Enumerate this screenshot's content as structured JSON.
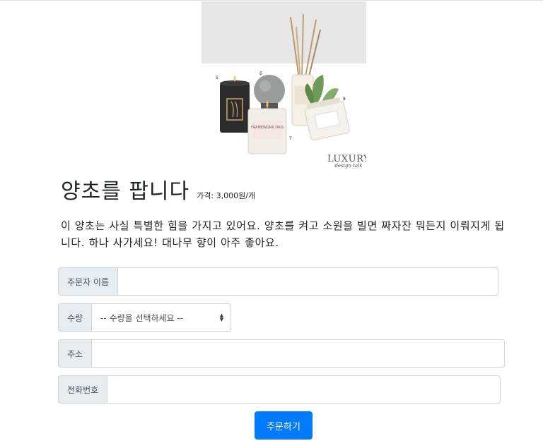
{
  "product": {
    "title": "양초를 팝니다",
    "price": "가격: 3,000원/개",
    "description": "이 양초는 사실 특별한 힘을 가지고 있어요. 양초를 켜고 소원을 빌면 짜자잔 뭐든지 이뤄지게 됩니다. 하나 사가세요! 대나무 향이 아주 좋아요.",
    "image": {
      "watermark_line1": "LUXURY",
      "watermark_line2": "design talk",
      "candle_labels": [
        "5",
        "6",
        "8",
        "7"
      ],
      "jar_label": "FRAMEWORK DAIS"
    }
  },
  "form": {
    "name": {
      "label": "주문자 이름",
      "value": "",
      "placeholder": ""
    },
    "quantity": {
      "label": "수량",
      "selected": "-- 수량을 선택하세요 --"
    },
    "address": {
      "label": "주소",
      "value": "",
      "placeholder": ""
    },
    "phone": {
      "label": "전화번호",
      "value": "",
      "placeholder": ""
    },
    "submit_label": "주문하기"
  },
  "colors": {
    "primary": "#007bff",
    "addon_bg": "#e9ecef",
    "border": "#ced4da"
  }
}
